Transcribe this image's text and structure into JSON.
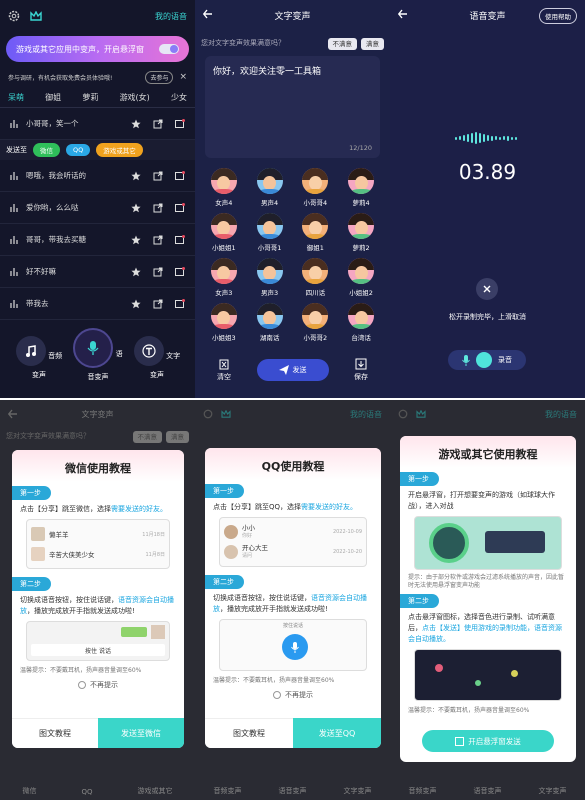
{
  "p1": {
    "banner": "游戏或其它应用中变声，开启悬浮窗",
    "my_voice": "我的语音",
    "notice": "参与调研，有机会获取免费会员体验哦!",
    "notice_btn": "去参与",
    "notice_close": "×",
    "tabs": [
      "呆萌",
      "御姐",
      "萝莉",
      "游戏(女)",
      "少女"
    ],
    "rows": [
      "小哥哥，笑一个",
      "嗯哦，我会听话的",
      "爱你哟，么么哒",
      "哥哥，带我去买糖",
      "好不好嘛",
      "带我去"
    ],
    "share_label": "发送至",
    "share": [
      "微信",
      "QQ",
      "游戏或其它"
    ],
    "nav": [
      "音频变声",
      "语音变声",
      "文字变声"
    ]
  },
  "p2": {
    "title": "文字变声",
    "question": "您对文字变声效果满意吗？",
    "btn_no": "不满意",
    "btn_yes": "满意",
    "text": "你好，欢迎关注零一工具箱",
    "count": "12/120",
    "voices": [
      "女声4",
      "男声4",
      "小哥哥4",
      "萝莉4",
      "小姐姐1",
      "小哥哥1",
      "御姐1",
      "萝莉2",
      "女声3",
      "男声3",
      "四川话",
      "小姐姐2",
      "小姐姐3",
      "湖南话",
      "小哥哥2",
      "台湾话"
    ],
    "clear": "清空",
    "send": "发送",
    "save": "保存"
  },
  "p3": {
    "title": "语音变声",
    "help": "使用帮助",
    "timer": "03.89",
    "hint": "松开录制完毕，上滑取消",
    "record": "录音"
  },
  "p4": {
    "title": "微信使用教程",
    "step1": "第一步",
    "s1_pre": "点击【分享】跳至微信，选择",
    "s1_hl": "需要发送的好友。",
    "contacts": [
      "懒羊羊",
      "辛苦大侠美少女"
    ],
    "dates": [
      "11月18日",
      "11月8日"
    ],
    "step2": "第二步",
    "s2_pre": "切换成语音按钮，按住说话键，",
    "s2_hl": "语音资源会自动播放",
    "s2_post": "，播放完成放开手指就发送成功啦!",
    "bubble": "按住 说话",
    "tip": "温馨提示：不要戴耳机，扬声器音量调至60%",
    "noshow": "不再提示",
    "btn_left": "图文教程",
    "btn_right": "发送至微信",
    "bg_top": "文字变声",
    "bg_q": "您对文字变声效果满意吗？",
    "bg_no": "不满意",
    "bg_yes": "满意",
    "bg_nav": [
      "微信",
      "QQ",
      "游戏或其它"
    ]
  },
  "p5": {
    "title": "QQ使用教程",
    "step1": "第一步",
    "s1_pre": "点击【分享】跳至QQ，选择",
    "s1_hl": "需要发送的好友。",
    "contacts": [
      "小小",
      "开心大王"
    ],
    "subs": [
      "你好",
      "请问"
    ],
    "dates": [
      "2022-10-09",
      "2022-10-20"
    ],
    "step2": "第二步",
    "s2_pre": "切换成语音按钮，按住说话键，",
    "s2_hl": "语音资源会自动播放",
    "s2_post": "，播放完成放开手指就发送成功啦!",
    "press": "按住说话",
    "tip": "温馨提示：不要戴耳机，扬声器音量调至60%",
    "noshow": "不再提示",
    "btn_left": "图文教程",
    "btn_right": "发送至QQ",
    "bg_my": "我的语音",
    "bg_nav": [
      "音频变声",
      "语音变声",
      "文字变声"
    ]
  },
  "p6": {
    "title": "游戏或其它使用教程",
    "step1": "第一步",
    "s1": "开启悬浮窗，打开想要变声的游戏（如球球大作战），进入对战",
    "s1_tip": "提示：由于部分软件或游戏会过滤系统播放的声音，因此暂时无法使用悬浮窗变声功能",
    "step2": "第二步",
    "s2_pre": "点击悬浮窗图标，选择音色进行录制、试听满意后，",
    "s2_hl": "点击【发送】使用游戏的录制功能，语音资源会自动播放。",
    "tip": "温馨提示：不要戴耳机，扬声器音量调至60%",
    "btn": "开启悬浮窗发送",
    "bg_my": "我的语音",
    "bg_nav": [
      "音频变声",
      "语音变声",
      "文字变声"
    ]
  },
  "colors": {
    "accent": "#3ad6c9",
    "bg": "#14162a",
    "navy": "#1c2146",
    "blue": "#1aa6e0"
  }
}
